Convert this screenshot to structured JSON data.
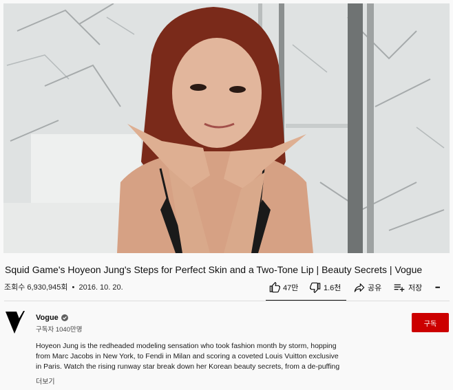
{
  "video": {
    "title": "Squid Game's Hoyeon Jung's Steps for Perfect Skin and a Two-Tone Lip | Beauty Secrets | Vogue",
    "views": "조회수 6,930,945회",
    "separator": "•",
    "date": "2016. 10. 20."
  },
  "actions": {
    "like_count": "47만",
    "dislike_count": "1.6천",
    "share_label": "공유",
    "save_label": "저장",
    "more_label": "•••"
  },
  "channel": {
    "name": "Vogue",
    "subscribers": "구독자 1040만명",
    "subscribe_label": "구독"
  },
  "description": {
    "lines": [
      "Hoyeon Jung is the redheaded modeling sensation who took fashion month by storm, hopping",
      "from Marc Jacobs in New York, to Fendi in Milan and scoring a coveted Louis Vuitton exclusive",
      "in Paris. Watch the rising runway star break down her Korean beauty secrets, from a de-puffing"
    ],
    "show_more": "더보기"
  },
  "colors": {
    "subscribe_bg": "#cc0000",
    "page_bg": "#f9f9f9"
  }
}
